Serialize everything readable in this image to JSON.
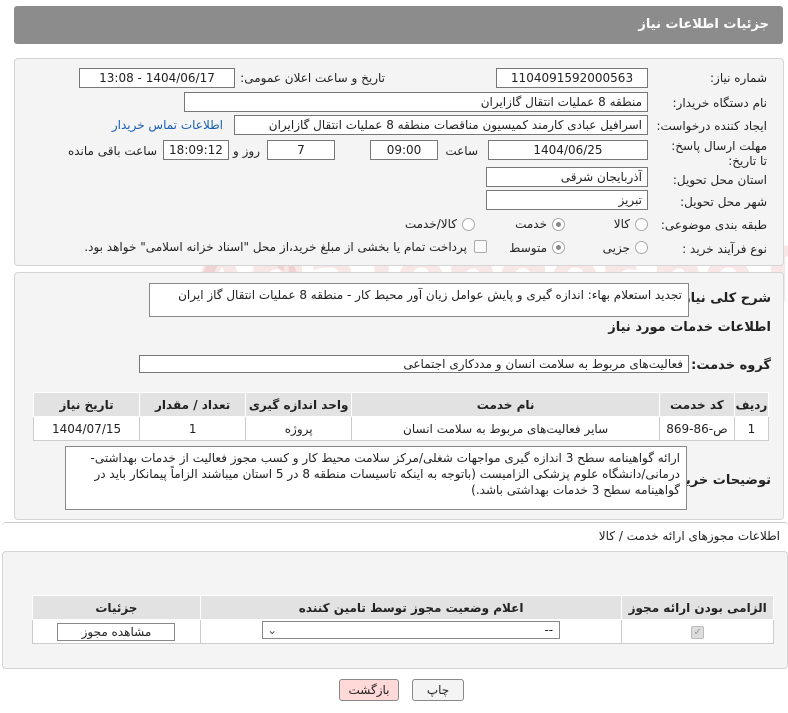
{
  "header": {
    "title": "جزئیات اطلاعات نیاز"
  },
  "form": {
    "need_number_label": "شماره نیاز:",
    "need_number": "1104091592000563",
    "announce_label": "تاریخ و ساعت اعلان عمومی:",
    "announce_value": "1404/06/17 - 13:08",
    "buyer_org_label": "نام دستگاه خریدار:",
    "buyer_org": "منطقه 8 عملیات انتقال گازایران",
    "requester_label": "ایجاد کننده درخواست:",
    "requester": "اسرافیل عبادی کارمند کمیسیون مناقصات منطقه 8 عملیات انتقال گازایران",
    "contact_link": "اطلاعات تماس خریدار",
    "deadline_label": "مهلت ارسال پاسخ: تا تاریخ:",
    "deadline_date": "1404/06/25",
    "time_label": "ساعت",
    "deadline_time": "09:00",
    "days_value": "7",
    "days_label": "روز و",
    "remaining_time": "18:09:12",
    "remaining_label": "ساعت باقی مانده",
    "province_label": "استان محل تحویل:",
    "province": "آذربایجان شرقی",
    "city_label": "شهر محل تحویل:",
    "city": "تبریز",
    "category_label": "طبقه بندی موضوعی:",
    "category_options": [
      "کالا",
      "خدمت",
      "کالا/خدمت"
    ],
    "category_selected": "خدمت",
    "process_label": "نوع فرآیند خرید :",
    "process_options": [
      "جزیی",
      "متوسط"
    ],
    "process_selected": "متوسط",
    "payment_note": "پرداخت تمام یا بخشی از مبلغ خرید،از محل \"اسناد خزانه اسلامی\" خواهد بود."
  },
  "summary": {
    "label": "شرح کلی نیاز:",
    "text": "تجدید استعلام بهاء: اندازه گیری و پایش عوامل زیان آور محیط کار - منطقه 8 عملیات انتقال گاز ایران"
  },
  "services": {
    "title": "اطلاعات خدمات مورد نیاز",
    "group_label": "گروه خدمت:",
    "group_value": "فعالیت‌های مربوط به سلامت انسان و مددکاری اجتماعی",
    "columns": [
      "ردیف",
      "کد خدمت",
      "نام خدمت",
      "واحد اندازه گیری",
      "تعداد / مقدار",
      "تاریخ نیاز"
    ],
    "rows": [
      {
        "row": "1",
        "code": "ص-86-869",
        "name": "سایر فعالیت‌های مربوط به سلامت انسان",
        "unit": "پروژه",
        "qty": "1",
        "date": "1404/07/15"
      }
    ]
  },
  "buyer_notes": {
    "label": "توضیحات خریدار:",
    "text": "ارائه گواهینامه سطح 3 اندازه گیری مواجهات شغلی/مرکز سلامت محیط کار و کسب مجوز فعالیت از خدمات بهداشتی-درمانی/دانشگاه علوم پزشکی الزامیست (باتوجه به اینکه تاسیسات منطقه 8 در 5 استان میباشند الزاماً پیمانکار باید در گواهینامه سطح 3 خدمات بهداشتی باشد.)"
  },
  "permits": {
    "title": "اطلاعات مجوزهای ارائه خدمت / کالا",
    "columns": [
      "الزامی بودن ارائه مجوز",
      "اعلام وضعیت مجوز توسط تامین کننده",
      "جزئیات"
    ],
    "select_value": "--",
    "view_button": "مشاهده مجوز"
  },
  "footer": {
    "print_button": "چاپ",
    "back_button": "بازگشت"
  },
  "watermark": "AriaTender.neT"
}
